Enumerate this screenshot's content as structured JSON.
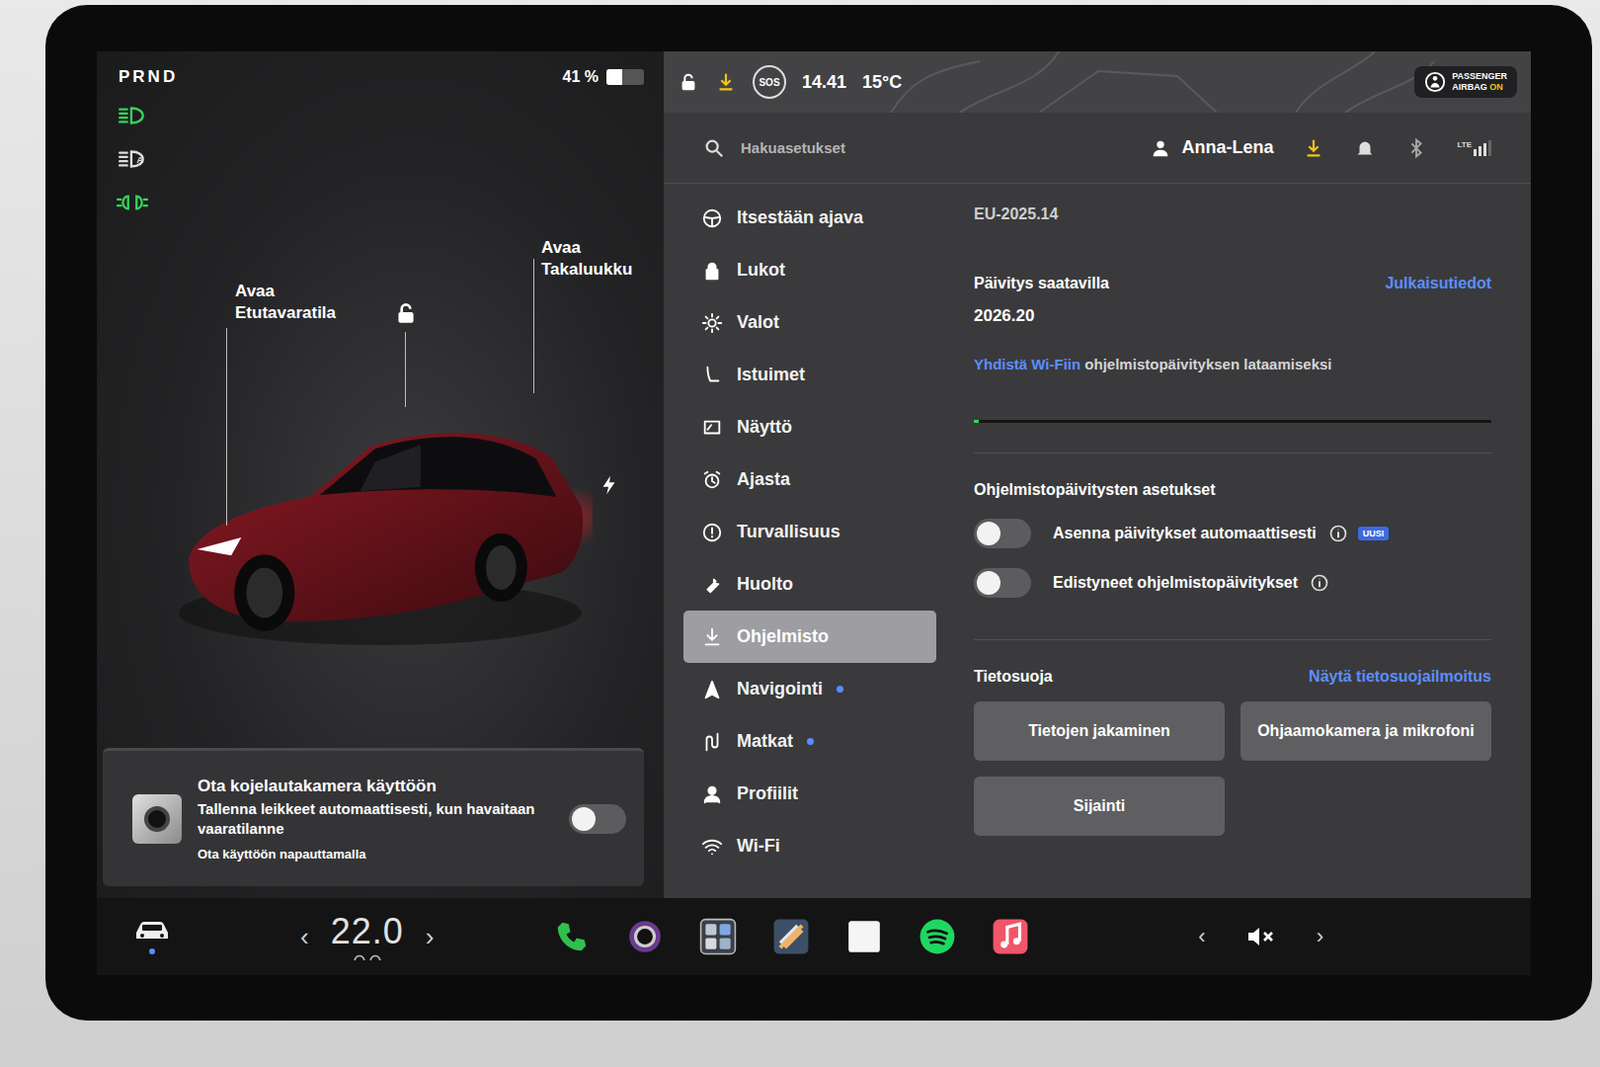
{
  "left_panel": {
    "gear": "PRND",
    "battery": {
      "percent": "41 %",
      "level": 0.41
    },
    "light_indicators": [
      {
        "kind": "headlights",
        "label": "",
        "on": true
      },
      {
        "kind": "auto-high-beam",
        "label": "A",
        "on": false
      },
      {
        "kind": "parking-lights",
        "label": "",
        "on": true
      }
    ],
    "car": {
      "frunk_label": [
        "Avaa",
        "Etutavaratila"
      ],
      "trunk_label": [
        "Avaa",
        "Takaluukku"
      ],
      "locked": false
    },
    "dashcam_card": {
      "title": "Ota kojelautakamera käyttöön",
      "description": "Tallenna leikkeet automaattisesti, kun havaitaan vaaratilanne",
      "hint": "Ota käyttöön napauttamalla",
      "enabled": false
    }
  },
  "status_bar": {
    "locked": false,
    "sos": "SOS",
    "time": "14.41",
    "temperature": "15°C",
    "airbag": {
      "line1": "PASSENGER",
      "line2": "AIRBAG",
      "state": "ON"
    }
  },
  "header": {
    "search_placeholder": "Hakuasetukset",
    "user": "Anna-Lena",
    "network": "LTE",
    "signal_level": 0.75
  },
  "menu": [
    {
      "label": "Itsestään ajava",
      "kind": "steering",
      "selected": false,
      "dot": false
    },
    {
      "label": "Lukot",
      "kind": "lock",
      "selected": false,
      "dot": false
    },
    {
      "label": "Valot",
      "kind": "lights",
      "selected": false,
      "dot": false
    },
    {
      "label": "Istuimet",
      "kind": "seat",
      "selected": false,
      "dot": false
    },
    {
      "label": "Näyttö",
      "kind": "display",
      "selected": false,
      "dot": false
    },
    {
      "label": "Ajasta",
      "kind": "schedule",
      "selected": false,
      "dot": false
    },
    {
      "label": "Turvallisuus",
      "kind": "safety",
      "selected": false,
      "dot": false
    },
    {
      "label": "Huolto",
      "kind": "service",
      "selected": false,
      "dot": false
    },
    {
      "label": "Ohjelmisto",
      "kind": "software",
      "selected": true,
      "dot": false
    },
    {
      "label": "Navigointi",
      "kind": "navigation",
      "selected": false,
      "dot": true
    },
    {
      "label": "Matkat",
      "kind": "trips",
      "selected": false,
      "dot": true
    },
    {
      "label": "Profiilit",
      "kind": "profiles",
      "selected": false,
      "dot": false
    },
    {
      "label": "Wi-Fi",
      "kind": "wifi",
      "selected": false,
      "dot": false
    }
  ],
  "software": {
    "current_version": "EU-2025.14",
    "update_title": "Päivitys saatavilla",
    "release_notes_link": "Julkaisutiedot",
    "new_version": "2026.20",
    "wifi_link": "Yhdistä Wi-Fiin",
    "wifi_text": " ohjelmistopäivityksen lataamiseksi",
    "download_level": 0.01,
    "settings_title": "Ohjelmistopäivitysten asetukset",
    "toggles": [
      {
        "label": "Asenna päivitykset automaattisesti",
        "on": false,
        "badge": "UUSI"
      },
      {
        "label": "Edistyneet ohjelmistopäivitykset",
        "on": false,
        "badge": ""
      }
    ],
    "privacy_title": "Tietosuoja",
    "privacy_link": "Näytä tietosuojailmoitus",
    "privacy_buttons": [
      "Tietojen jakaminen",
      "Ohjaamokamera ja mikrofoni",
      "Sijainti"
    ]
  },
  "dock": {
    "car_selected": true,
    "climate": {
      "left_arrow": "‹",
      "value": "22.0",
      "right_arrow": "›"
    },
    "apps": [
      {
        "kind": "phone"
      },
      {
        "kind": "camera"
      },
      {
        "kind": "apps"
      },
      {
        "kind": "toybox"
      },
      {
        "kind": "notes"
      },
      {
        "kind": "spotify"
      },
      {
        "kind": "music"
      }
    ],
    "volume": {
      "left_arrow": "‹",
      "right_arrow": "›",
      "muted": true
    }
  }
}
